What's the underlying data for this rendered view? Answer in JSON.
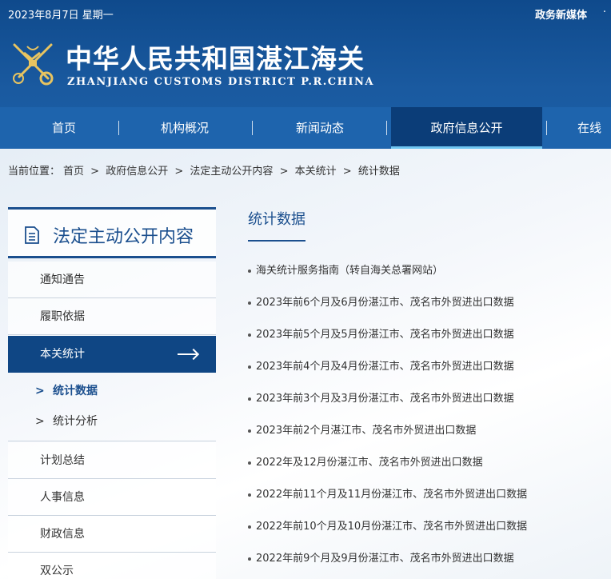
{
  "topbar": {
    "date": "2023年8月7日 星期一",
    "media": "政务新媒体",
    "more": "·"
  },
  "site": {
    "title_cn": "中华人民共和国湛江海关",
    "title_en": "ZHANJIANG CUSTOMS DISTRICT P.R.CHINA"
  },
  "nav": [
    {
      "label": "首页"
    },
    {
      "label": "机构概况"
    },
    {
      "label": "新闻动态"
    },
    {
      "label": "政府信息公开"
    },
    {
      "label": "在线"
    }
  ],
  "breadcrumb": {
    "prefix": "当前位置：",
    "items": [
      "首页",
      "政府信息公开",
      "法定主动公开内容",
      "本关统计",
      "统计数据"
    ],
    "sep": ">"
  },
  "sidebar": {
    "title": "法定主动公开内容",
    "items": [
      {
        "label": "通知通告"
      },
      {
        "label": "履职依据"
      },
      {
        "label": "本关统计"
      },
      {
        "label": "统计数据"
      },
      {
        "label": "统计分析"
      },
      {
        "label": "计划总结"
      },
      {
        "label": "人事信息"
      },
      {
        "label": "财政信息"
      },
      {
        "label": "双公示"
      }
    ],
    "chevron": ">"
  },
  "main": {
    "title": "统计数据",
    "list": [
      "海关统计服务指南（转自海关总署网站）",
      "2023年前6个月及6月份湛江市、茂名市外贸进出口数据",
      "2023年前5个月及5月份湛江市、茂名市外贸进出口数据",
      "2023年前4个月及4月份湛江市、茂名市外贸进出口数据",
      "2023年前3个月及3月份湛江市、茂名市外贸进出口数据",
      "2023年前2个月湛江市、茂名市外贸进出口数据",
      "2022年及12月份湛江市、茂名市外贸进出口数据",
      "2022年前11个月及11月份湛江市、茂名市外贸进出口数据",
      "2022年前10个月及10月份湛江市、茂名市外贸进出口数据",
      "2022年前9个月及9月份湛江市、茂名市外贸进出口数据"
    ]
  },
  "colors": {
    "brand": "#1b4f8e",
    "nav": "#1e64ad",
    "nav_active": "#0b3d78",
    "accent": "#6fc6f2"
  }
}
